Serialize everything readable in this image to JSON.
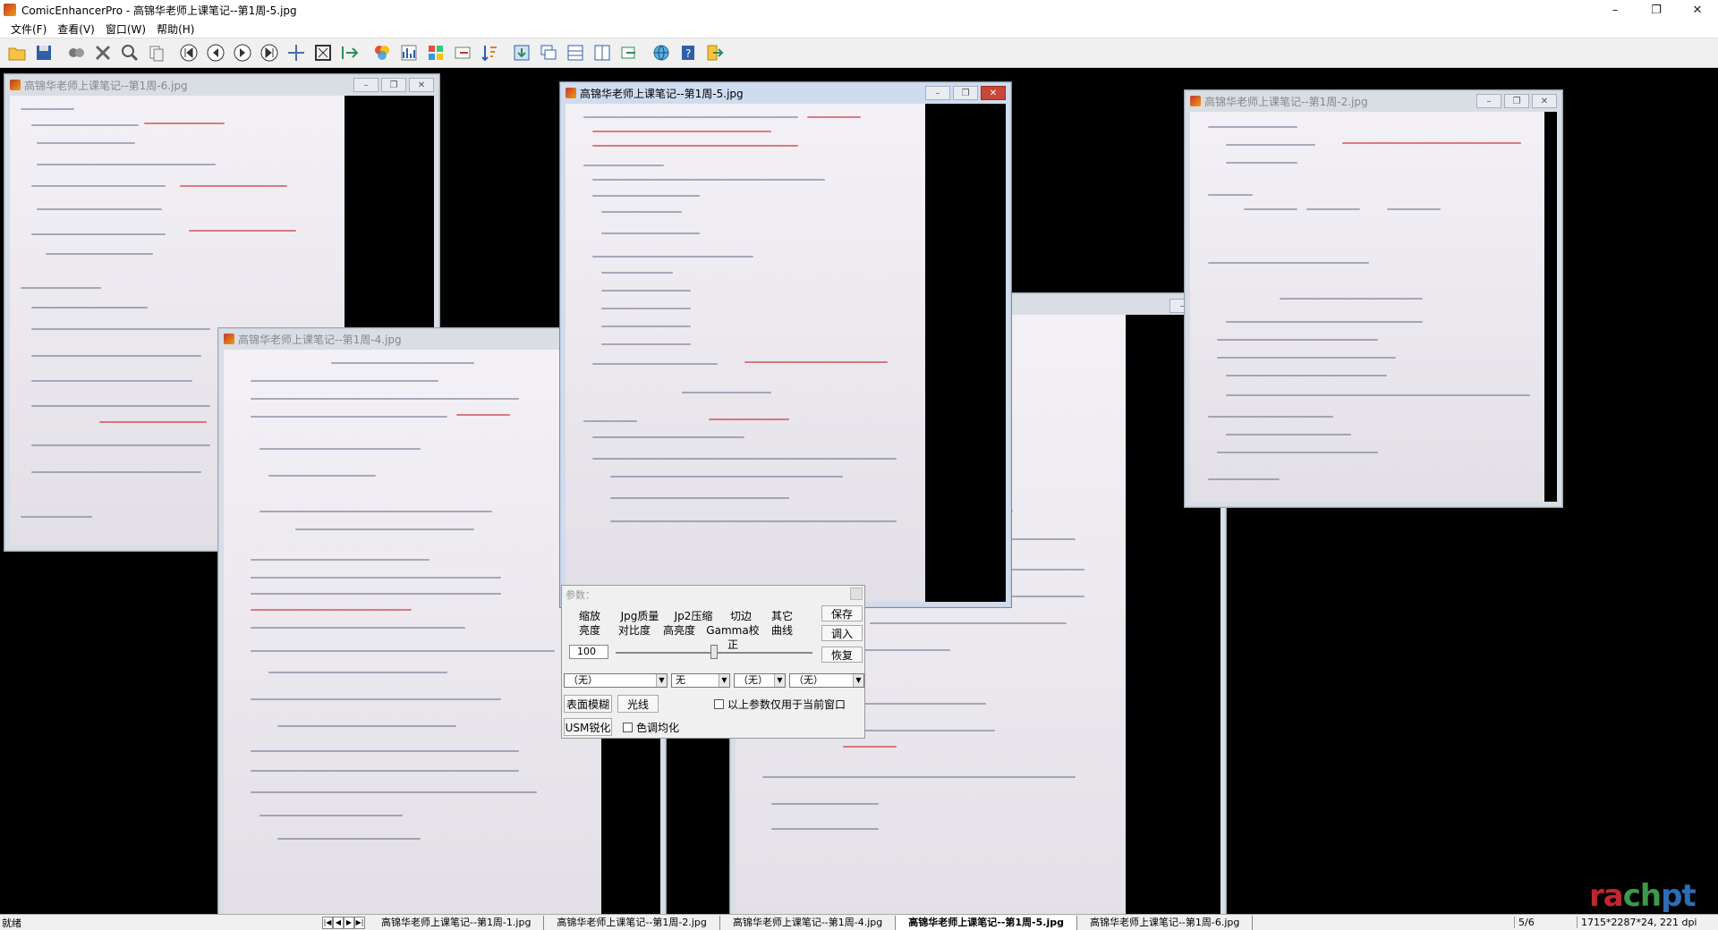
{
  "window": {
    "title": "ComicEnhancerPro - 高锦华老师上课笔记--第1周-5.jpg",
    "controls": [
      "–",
      "❐",
      "✕"
    ]
  },
  "menu": [
    "文件(F)",
    "查看(V)",
    "窗口(W)",
    "帮助(H)"
  ],
  "toolbar_icons": [
    "open-folder-icon",
    "save-icon",
    "batch-icon",
    "tools-icon",
    "find-icon",
    "copy-icon",
    "first-icon",
    "prev-icon",
    "play-icon",
    "last-icon",
    "move-icon",
    "fit-icon",
    "export-icon",
    "color-icon",
    "chart-icon",
    "palette-icon",
    "crop-icon",
    "sort-icon",
    "import-icon",
    "window-icon",
    "split-h-icon",
    "split-v-icon",
    "refresh-icon",
    "globe-icon",
    "help-icon",
    "exit-icon"
  ],
  "child_windows": [
    {
      "id": "w6",
      "title": "高锦华老师上课笔记--第1周-6.jpg"
    },
    {
      "id": "w4",
      "title": "高锦华老师上课笔记--第1周-4.jpg"
    },
    {
      "id": "w5",
      "title": "高锦华老师上课笔记--第1周-5.jpg"
    },
    {
      "id": "w2",
      "title": "高锦华老师上课笔记--第1周-2.jpg"
    }
  ],
  "params": {
    "title": "参数：",
    "tabs_row1": [
      "缩放",
      "Jpg质量",
      "Jp2压缩",
      "切边",
      "其它"
    ],
    "tabs_row2": [
      "亮度",
      "对比度",
      "高亮度",
      "Gamma校正",
      "曲线"
    ],
    "btn_save": "保存",
    "btn_load": "调入",
    "btn_restore": "恢复",
    "value": "100",
    "slider_position": 0.5,
    "selects": [
      "（无）",
      "无",
      "（无）",
      "（无）"
    ],
    "btn_surface_blur": "表面模糊",
    "btn_ray": "光线",
    "btn_usm": "USM锐化",
    "chk_current_window": "以上参数仅用于当前窗口",
    "chk_tone_equalize": "色调均化"
  },
  "status": {
    "ready": "就绪",
    "nav": [
      "|◀",
      "◀",
      "▶",
      "▶|"
    ],
    "tabs": [
      "高锦华老师上课笔记--第1周-1.jpg",
      "高锦华老师上课笔记--第1周-2.jpg",
      "高锦华老师上课笔记--第1周-4.jpg",
      "高锦华老师上课笔记--第1周-5.jpg",
      "高锦华老师上课笔记--第1周-6.jpg"
    ],
    "active_tab_index": 3,
    "count": "5/6",
    "info": "1715*2287*24, 221 dpi"
  },
  "watermark": {
    "w1": "ra",
    "w2": "ch",
    "w3": "pt"
  }
}
